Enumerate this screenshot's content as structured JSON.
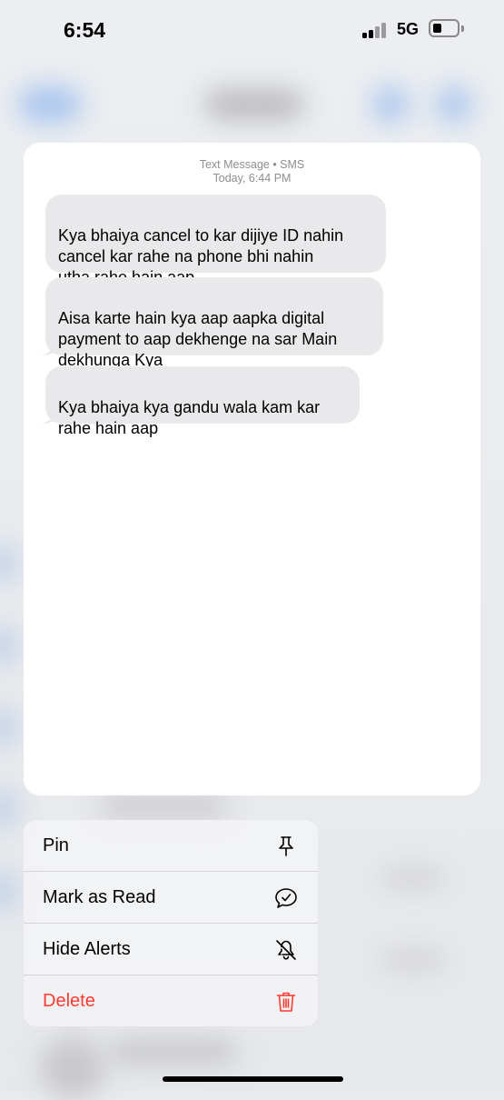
{
  "status_bar": {
    "time": "6:54",
    "network": "5G"
  },
  "conversation": {
    "meta_type": "Text Message • SMS",
    "meta_time": "Today, 6:44 PM",
    "messages": [
      "Kya bhaiya cancel to kar dijiye ID nahin\ncancel kar rahe na phone bhi nahin\nutha rahe hain aap",
      "Aisa karte hain kya aap aapka digital\npayment to aap dekhenge na sar Main\ndekhunga Kya",
      "Kya bhaiya kya gandu wala kam kar\nrahe hain aap"
    ]
  },
  "context_menu": {
    "items": [
      {
        "label": "Pin",
        "icon": "pin-icon"
      },
      {
        "label": "Mark as Read",
        "icon": "message-check-icon"
      },
      {
        "label": "Hide Alerts",
        "icon": "bell-slash-icon"
      },
      {
        "label": "Delete",
        "icon": "trash-icon"
      }
    ]
  },
  "colors": {
    "destructive": "#ff3b30",
    "bubble": "#e9e9eb",
    "meta_text": "#8e8e93"
  }
}
